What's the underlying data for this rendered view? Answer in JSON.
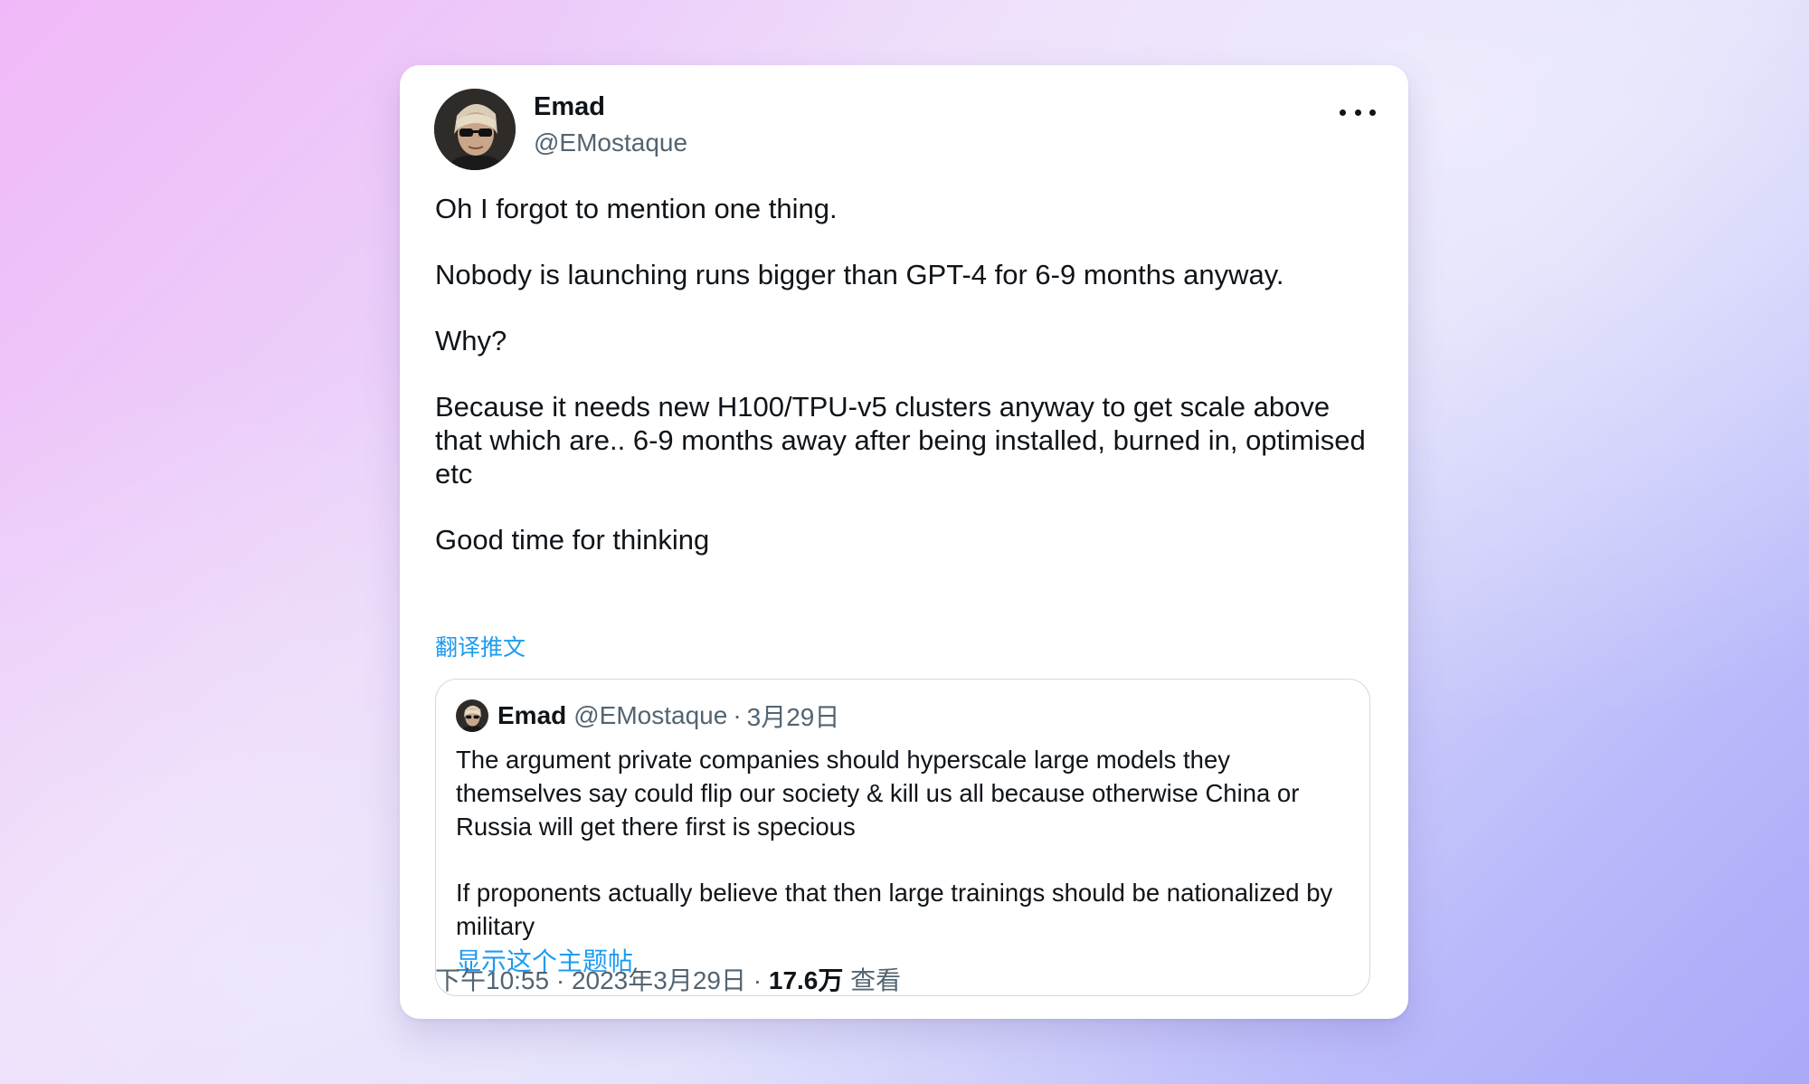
{
  "tweet": {
    "author": {
      "name": "Emad",
      "handle": "@EMostaque"
    },
    "more_icon": "more-horizontal-icon",
    "paragraphs": [
      "Oh I forgot to mention one thing.",
      "Nobody is launching runs bigger than GPT-4 for 6-9 months anyway.",
      "Why?",
      "Because it needs new H100/TPU-v5 clusters anyway to get scale above that which are.. 6-9 months away after being installed, burned in, optimised etc",
      "Good time for thinking"
    ],
    "translate_label": "翻译推文",
    "quoted_tweet": {
      "name": "Emad",
      "handle": "@EMostaque",
      "separator": "·",
      "date": "3月29日",
      "paragraphs": [
        "The argument private companies should hyperscale large models they themselves say could flip our society & kill us all because otherwise China or Russia will get there first is specious",
        "If proponents actually believe that then large trainings should be nationalized by military"
      ],
      "show_thread_label": "显示这个主题帖"
    },
    "meta": {
      "time": "下午10:55",
      "separator": "·",
      "date": "2023年3月29日",
      "views_count": "17.6万",
      "views_label": "查看"
    }
  },
  "colors": {
    "link": "#1d9bf0",
    "secondary_text": "#536471",
    "primary_text": "#0f1419",
    "border": "#cfd9de"
  }
}
